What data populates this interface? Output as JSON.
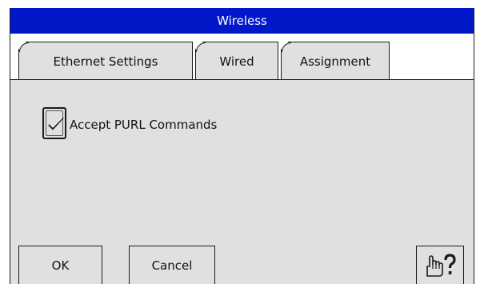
{
  "window": {
    "title": "Wireless"
  },
  "tabs": [
    {
      "label": "Ethernet Settings",
      "selected": false
    },
    {
      "label": "Wired",
      "selected": false
    },
    {
      "label": "Assignment",
      "selected": true
    }
  ],
  "content": {
    "checkbox": {
      "label": "Accept PURL Commands",
      "checked": true
    }
  },
  "buttons": {
    "ok": "OK",
    "cancel": "Cancel",
    "help_icon": "hand-pointer-question-icon"
  },
  "colors": {
    "titlebar": "#0018c8",
    "panel": "#e0e0e0",
    "border": "#1a1a1a"
  }
}
